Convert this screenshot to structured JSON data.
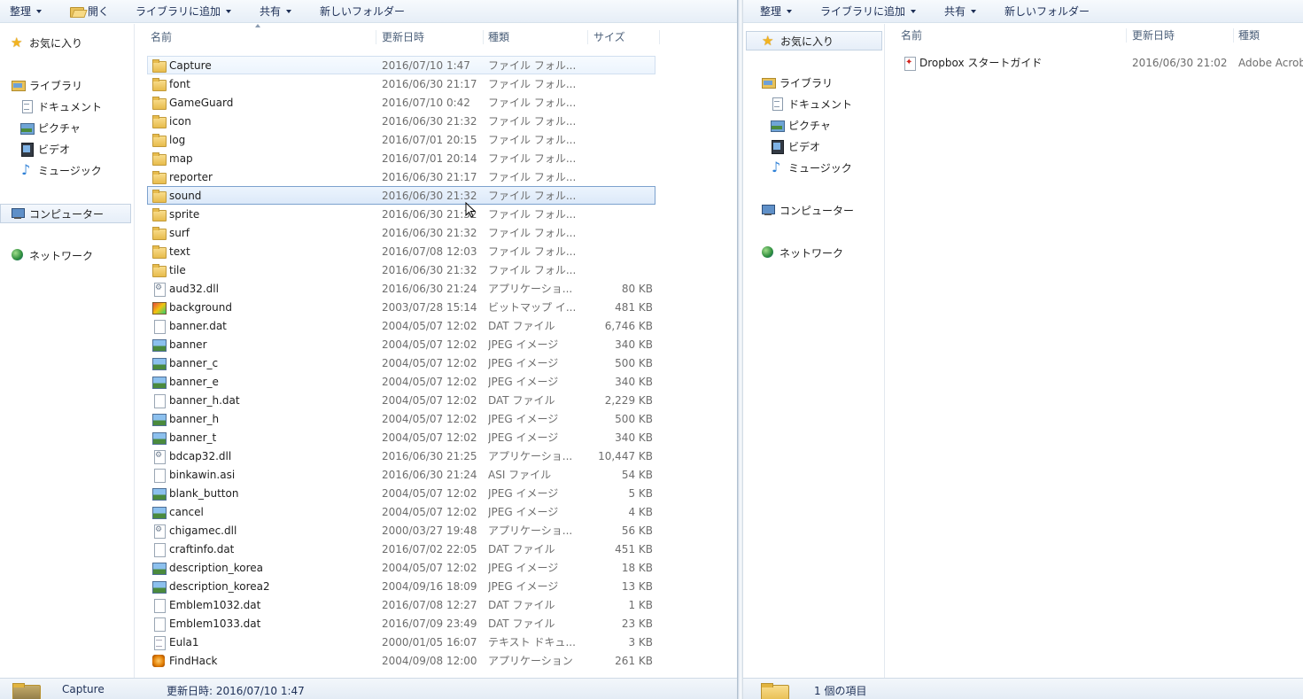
{
  "left": {
    "toolbar": {
      "organize": "整理",
      "open": "開く",
      "add_library": "ライブラリに追加",
      "share": "共有",
      "new_folder": "新しいフォルダー"
    },
    "nav": {
      "favorites": "お気に入り",
      "libraries": "ライブラリ",
      "documents": "ドキュメント",
      "pictures": "ピクチャ",
      "videos": "ビデオ",
      "music": "ミュージック",
      "computer": "コンピューター",
      "network": "ネットワーク"
    },
    "columns": {
      "name": "名前",
      "date": "更新日時",
      "type": "種類",
      "size": "サイズ"
    },
    "files": [
      {
        "name": "Capture",
        "date": "2016/07/10 1:47",
        "type": "ファイル フォル...",
        "size": "",
        "icon": "folder"
      },
      {
        "name": "font",
        "date": "2016/06/30 21:17",
        "type": "ファイル フォル...",
        "size": "",
        "icon": "folder"
      },
      {
        "name": "GameGuard",
        "date": "2016/07/10 0:42",
        "type": "ファイル フォル...",
        "size": "",
        "icon": "folder"
      },
      {
        "name": "icon",
        "date": "2016/06/30 21:32",
        "type": "ファイル フォル...",
        "size": "",
        "icon": "folder"
      },
      {
        "name": "log",
        "date": "2016/07/01 20:15",
        "type": "ファイル フォル...",
        "size": "",
        "icon": "folder"
      },
      {
        "name": "map",
        "date": "2016/07/01 20:14",
        "type": "ファイル フォル...",
        "size": "",
        "icon": "folder"
      },
      {
        "name": "reporter",
        "date": "2016/06/30 21:17",
        "type": "ファイル フォル...",
        "size": "",
        "icon": "folder"
      },
      {
        "name": "sound",
        "date": "2016/06/30 21:32",
        "type": "ファイル フォル...",
        "size": "",
        "icon": "folder"
      },
      {
        "name": "sprite",
        "date": "2016/06/30 21:32",
        "type": "ファイル フォル...",
        "size": "",
        "icon": "folder"
      },
      {
        "name": "surf",
        "date": "2016/06/30 21:32",
        "type": "ファイル フォル...",
        "size": "",
        "icon": "folder"
      },
      {
        "name": "text",
        "date": "2016/07/08 12:03",
        "type": "ファイル フォル...",
        "size": "",
        "icon": "folder"
      },
      {
        "name": "tile",
        "date": "2016/06/30 21:32",
        "type": "ファイル フォル...",
        "size": "",
        "icon": "folder"
      },
      {
        "name": "aud32.dll",
        "date": "2016/06/30 21:24",
        "type": "アプリケーショ...",
        "size": "80 KB",
        "icon": "dll"
      },
      {
        "name": "background",
        "date": "2003/07/28 15:14",
        "type": "ビットマップ イ...",
        "size": "481 KB",
        "icon": "bmp"
      },
      {
        "name": "banner.dat",
        "date": "2004/05/07 12:02",
        "type": "DAT ファイル",
        "size": "6,746 KB",
        "icon": "blank"
      },
      {
        "name": "banner",
        "date": "2004/05/07 12:02",
        "type": "JPEG イメージ",
        "size": "340 KB",
        "icon": "jpg"
      },
      {
        "name": "banner_c",
        "date": "2004/05/07 12:02",
        "type": "JPEG イメージ",
        "size": "500 KB",
        "icon": "jpg"
      },
      {
        "name": "banner_e",
        "date": "2004/05/07 12:02",
        "type": "JPEG イメージ",
        "size": "340 KB",
        "icon": "jpg"
      },
      {
        "name": "banner_h.dat",
        "date": "2004/05/07 12:02",
        "type": "DAT ファイル",
        "size": "2,229 KB",
        "icon": "blank"
      },
      {
        "name": "banner_h",
        "date": "2004/05/07 12:02",
        "type": "JPEG イメージ",
        "size": "500 KB",
        "icon": "jpg"
      },
      {
        "name": "banner_t",
        "date": "2004/05/07 12:02",
        "type": "JPEG イメージ",
        "size": "340 KB",
        "icon": "jpg"
      },
      {
        "name": "bdcap32.dll",
        "date": "2016/06/30 21:25",
        "type": "アプリケーショ...",
        "size": "10,447 KB",
        "icon": "dll"
      },
      {
        "name": "binkawin.asi",
        "date": "2016/06/30 21:24",
        "type": "ASI ファイル",
        "size": "54 KB",
        "icon": "blank"
      },
      {
        "name": "blank_button",
        "date": "2004/05/07 12:02",
        "type": "JPEG イメージ",
        "size": "5 KB",
        "icon": "jpg"
      },
      {
        "name": "cancel",
        "date": "2004/05/07 12:02",
        "type": "JPEG イメージ",
        "size": "4 KB",
        "icon": "jpg"
      },
      {
        "name": "chigamec.dll",
        "date": "2000/03/27 19:48",
        "type": "アプリケーショ...",
        "size": "56 KB",
        "icon": "dll"
      },
      {
        "name": "craftinfo.dat",
        "date": "2016/07/02 22:05",
        "type": "DAT ファイル",
        "size": "451 KB",
        "icon": "blank"
      },
      {
        "name": "description_korea",
        "date": "2004/05/07 12:02",
        "type": "JPEG イメージ",
        "size": "18 KB",
        "icon": "jpg"
      },
      {
        "name": "description_korea2",
        "date": "2004/09/16 18:09",
        "type": "JPEG イメージ",
        "size": "13 KB",
        "icon": "jpg"
      },
      {
        "name": "Emblem1032.dat",
        "date": "2016/07/08 12:27",
        "type": "DAT ファイル",
        "size": "1 KB",
        "icon": "blank"
      },
      {
        "name": "Emblem1033.dat",
        "date": "2016/07/09 23:49",
        "type": "DAT ファイル",
        "size": "23 KB",
        "icon": "blank"
      },
      {
        "name": "Eula1",
        "date": "2000/01/05 16:07",
        "type": "テキスト ドキュ...",
        "size": "3 KB",
        "icon": "txt"
      },
      {
        "name": "FindHack",
        "date": "2004/09/08 12:00",
        "type": "アプリケーション",
        "size": "261 KB",
        "icon": "exe"
      }
    ],
    "status": {
      "item_name": "Capture",
      "detail": "更新日時: 2016/07/10 1:47"
    }
  },
  "right": {
    "toolbar": {
      "organize": "整理",
      "add_library": "ライブラリに追加",
      "share": "共有",
      "new_folder": "新しいフォルダー"
    },
    "nav": {
      "favorites": "お気に入り",
      "libraries": "ライブラリ",
      "documents": "ドキュメント",
      "pictures": "ピクチャ",
      "videos": "ビデオ",
      "music": "ミュージック",
      "computer": "コンピューター",
      "network": "ネットワーク"
    },
    "columns": {
      "name": "名前",
      "date": "更新日時",
      "type": "種類"
    },
    "files": [
      {
        "name": "Dropbox スタートガイド",
        "date": "2016/06/30 21:02",
        "type": "Adobe Acrob",
        "icon": "pdf"
      }
    ],
    "status": {
      "count": "1 個の項目"
    }
  },
  "colors": {
    "toolbar_text": "#1e3057",
    "selection_border": "#7da2ce",
    "folder": "#e7bb4c"
  }
}
